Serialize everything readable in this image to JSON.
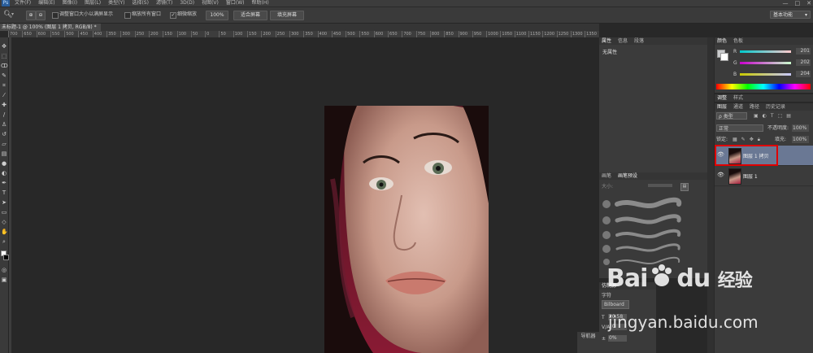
{
  "menu": {
    "logo": "Ps",
    "items": [
      "文件(F)",
      "编辑(E)",
      "图像(I)",
      "图层(L)",
      "类型(Y)",
      "选择(S)",
      "滤镜(T)",
      "3D(D)",
      "视图(V)",
      "窗口(W)",
      "帮助(H)"
    ],
    "window_controls": [
      "—",
      "□",
      "✕"
    ]
  },
  "options": {
    "resize_windows": "调整窗口大小以满屏显示",
    "zoom_all": "缩放所有窗口",
    "scrubby_zoom": "细微缩放",
    "zoom_100": "100%",
    "fit_screen": "适合屏幕",
    "fill_screen": "填充屏幕",
    "workspace": "基本功能"
  },
  "document": {
    "tab_title": "未标题-1 @ 100% (图层 1 拷贝, RGB/8) *",
    "ruler_ticks": [
      "700",
      "650",
      "600",
      "550",
      "500",
      "450",
      "400",
      "350",
      "300",
      "250",
      "200",
      "150",
      "100",
      "50",
      "0",
      "50",
      "100",
      "150",
      "200",
      "250",
      "300",
      "350",
      "400",
      "450",
      "500",
      "550",
      "600",
      "650",
      "700",
      "750",
      "800",
      "850",
      "900",
      "950",
      "1000",
      "1050",
      "1100",
      "1150",
      "1200",
      "1250",
      "1300",
      "1350"
    ]
  },
  "properties_panel": {
    "tabs": [
      "属性",
      "信息",
      "段落"
    ],
    "body": "无属性"
  },
  "brush_panel": {
    "tabs": [
      "画笔",
      "画笔预设"
    ],
    "size_label": "大小:"
  },
  "clone_panel": {
    "tabs": [
      "仿制源"
    ],
    "char_tab": "字符",
    "font_value": "Bilboard",
    "size_value": "20.58",
    "leading_value": "0",
    "tracking_value": "0%"
  },
  "navigator": {
    "label": "导航器"
  },
  "color_panel": {
    "tabs": [
      "颜色",
      "色板"
    ],
    "channels": [
      {
        "label": "R",
        "value": "201"
      },
      {
        "label": "G",
        "value": "202"
      },
      {
        "label": "B",
        "value": "204"
      }
    ],
    "fg_color": "#c9cacc",
    "bg_color": "#ffffff"
  },
  "adjust_tabs": [
    "调整",
    "样式"
  ],
  "layers_panel": {
    "tabs": [
      "图层",
      "通道",
      "路径",
      "历史记录"
    ],
    "filter_label": "ρ 类型",
    "blend_mode": "正常",
    "opacity_label": "不透明度:",
    "opacity_value": "100%",
    "lock_label": "锁定:",
    "fill_label": "填充:",
    "fill_value": "100%",
    "layers": [
      {
        "name": "图层 1 拷贝",
        "selected": true
      },
      {
        "name": "图层 1",
        "selected": false
      }
    ]
  },
  "watermark": {
    "brand": "Bai",
    "brand2": "du",
    "cn": "经验",
    "url": "jingyan.baidu.com"
  }
}
